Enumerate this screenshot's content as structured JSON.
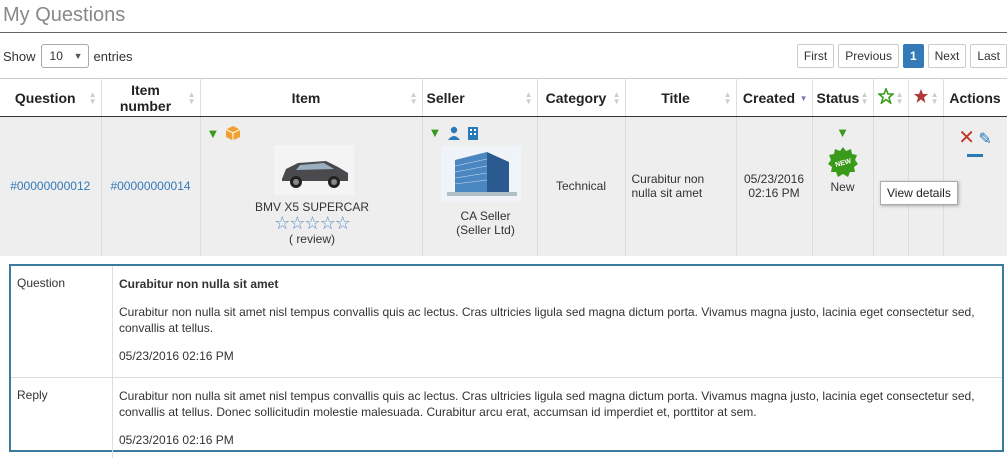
{
  "page": {
    "title": "My Questions"
  },
  "controls": {
    "show_label": "Show",
    "entries_value": "10",
    "entries_label": "entries"
  },
  "pager": {
    "first": "First",
    "previous": "Previous",
    "current": "1",
    "next": "Next",
    "last": "Last"
  },
  "table": {
    "headers": {
      "question": "Question",
      "item_number": "Item number",
      "item": "Item",
      "seller": "Seller",
      "category": "Category",
      "title": "Title",
      "created": "Created",
      "status": "Status",
      "actions": "Actions"
    },
    "row": {
      "question": "#00000000012",
      "item_number": "#00000000014",
      "item_name": "BMV X5 SUPERCAR",
      "review": "( review)",
      "seller_name": "CA Seller",
      "seller_company": "(Seller Ltd)",
      "category": "Technical",
      "title": "Curabitur non nulla sit amet",
      "created_date": "05/23/2016",
      "created_time": "02:16 PM",
      "status": "New",
      "badge_text": "NEW"
    }
  },
  "tooltip": "View details",
  "detail": {
    "question_label": "Question",
    "question_title": "Curabitur non nulla sit amet",
    "question_text": "Curabitur non nulla sit amet nisl tempus convallis quis ac lectus. Cras ultricies ligula sed magna dictum porta. Vivamus magna justo, lacinia eget consectetur sed, convallis at tellus.",
    "question_stamp": "05/23/2016 02:16 PM",
    "reply_label": "Reply",
    "reply_text": "Curabitur non nulla sit amet nisl tempus convallis quis ac lectus. Cras ultricies ligula sed magna dictum porta. Vivamus magna justo, lacinia eget consectetur sed, convallis at tellus. Donec sollicitudin molestie malesuada. Curabitur arcu erat, accumsan id imperdiet et, porttitor at sem.",
    "reply_stamp": "05/23/2016 02:16 PM"
  },
  "colors": {
    "accent": "#337ab7",
    "filter_green": "#3a9a1a",
    "delete_red": "#c0392b",
    "detail_border": "#3a7a9a"
  }
}
